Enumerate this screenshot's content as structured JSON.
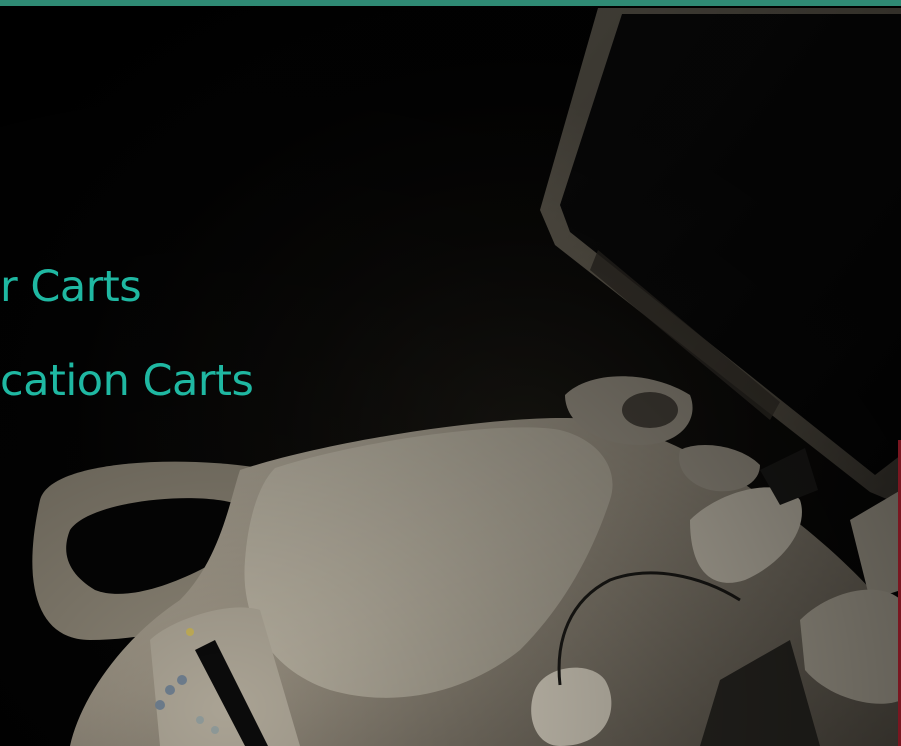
{
  "hero": {
    "headline_lines": [
      "r Carts",
      "cation Carts"
    ]
  },
  "colors": {
    "accent": "#2f8a74",
    "headline": "#1fb8a2",
    "background": "#000000",
    "edge": "#7a1620"
  },
  "image": {
    "subject_icon": "ultrasound-cart-photo"
  }
}
